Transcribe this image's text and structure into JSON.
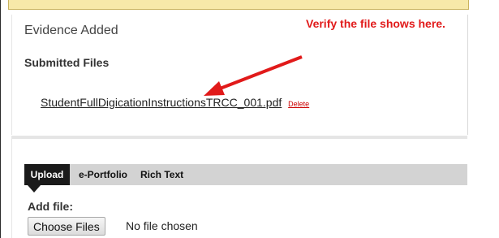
{
  "evidence": {
    "title": "Evidence Added",
    "submitted_label": "Submitted Files",
    "file_name": "StudentFullDigicationInstructionsTRCC_001.pdf",
    "delete_label": "Delete"
  },
  "annotation": {
    "text": "Verify the file shows here.",
    "color": "#e11a1a"
  },
  "tabs": [
    {
      "label": "Upload",
      "active": true
    },
    {
      "label": "e-Portfolio",
      "active": false
    },
    {
      "label": "Rich Text",
      "active": false
    }
  ],
  "upload": {
    "add_file_label": "Add file:",
    "choose_button_label": "Choose Files",
    "status_text": "No file chosen"
  },
  "colors": {
    "notice_bar": "#f7e9a9",
    "active_tab": "#1a1a1a",
    "tab_bar": "#d3d3d3",
    "delete_link": "#cc0000"
  }
}
